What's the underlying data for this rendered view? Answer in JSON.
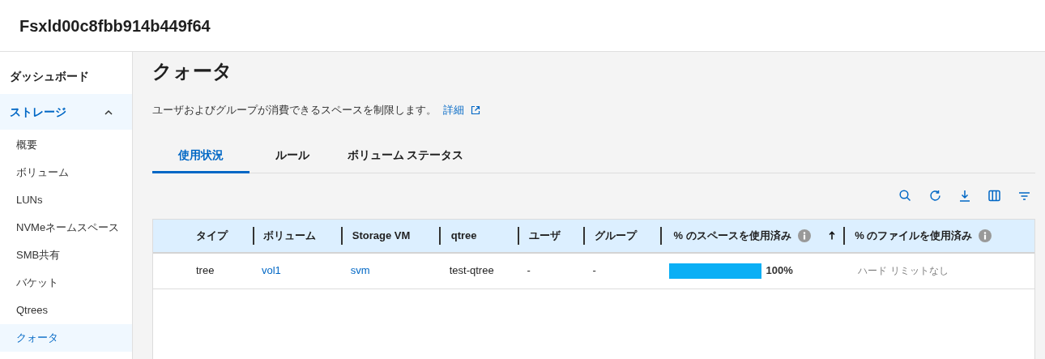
{
  "header": {
    "title": "Fsxld00c8fbb914b449f64"
  },
  "sidebar": {
    "items": [
      {
        "label": "ダッシュボード",
        "selected": false
      },
      {
        "label": "ストレージ",
        "expanded": true,
        "selected": true,
        "children": [
          {
            "label": "概要",
            "selected": false
          },
          {
            "label": "ボリューム",
            "selected": false
          },
          {
            "label": "LUNs",
            "selected": false
          },
          {
            "label": "NVMeネームスペース",
            "selected": false
          },
          {
            "label": "SMB共有",
            "selected": false
          },
          {
            "label": "バケット",
            "selected": false
          },
          {
            "label": "Qtrees",
            "selected": false
          },
          {
            "label": "クォータ",
            "selected": true
          }
        ]
      }
    ]
  },
  "page": {
    "title": "クォータ",
    "description": "ユーザおよびグループが消費できるスペースを制限します。",
    "link": "詳細"
  },
  "tabs": [
    {
      "label": "使用状況",
      "selected": true
    },
    {
      "label": "ルール",
      "selected": false
    },
    {
      "label": "ボリューム ステータス",
      "selected": false
    }
  ],
  "table": {
    "columns": [
      {
        "label": "タイプ",
        "info": false,
        "sorted": false
      },
      {
        "label": "ボリューム",
        "info": false,
        "sorted": false
      },
      {
        "label": "Storage VM",
        "info": false,
        "sorted": false
      },
      {
        "label": "qtree",
        "info": false,
        "sorted": false
      },
      {
        "label": "ユーザ",
        "info": false,
        "sorted": false
      },
      {
        "label": "グループ",
        "info": false,
        "sorted": false
      },
      {
        "label": "% のスペースを使用済み",
        "info": true,
        "sorted": true
      },
      {
        "label": "% のファイルを使用済み",
        "info": true,
        "sorted": false
      }
    ],
    "rows": [
      {
        "type": "tree",
        "volume": "vol1",
        "svm": "svm",
        "qtree": "test-qtree",
        "user": "-",
        "group": "-",
        "space_usage": {
          "level": 1.0,
          "reading": "100%"
        },
        "files": "ハード リミットなし"
      }
    ]
  }
}
